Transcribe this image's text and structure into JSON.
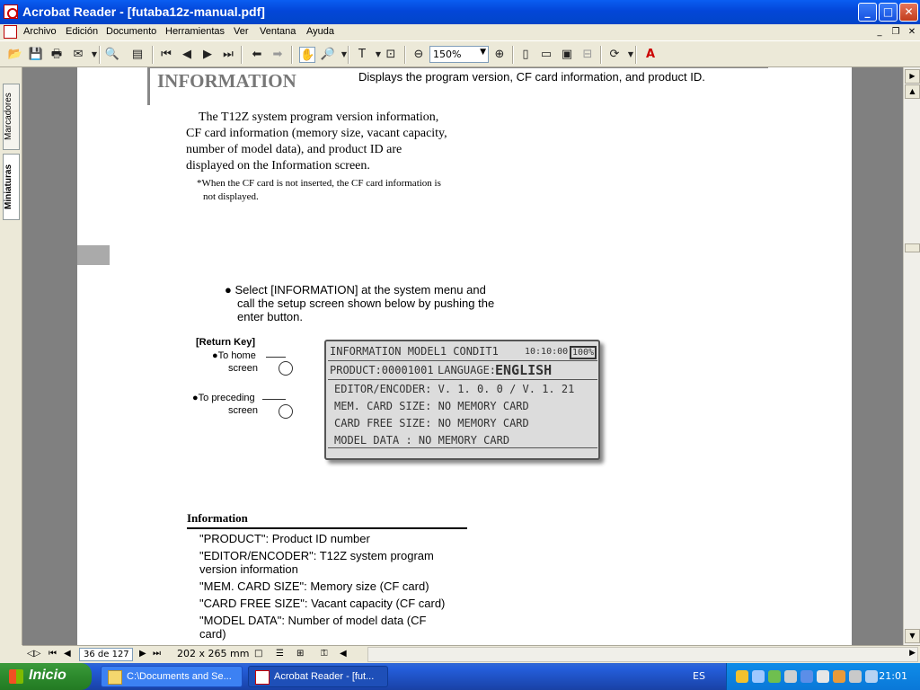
{
  "window": {
    "title": "Acrobat Reader - [futaba12z-manual.pdf]",
    "minimize": "_",
    "maximize": "□",
    "close": "✕"
  },
  "menu": [
    "Archivo",
    "Edición",
    "Documento",
    "Herramientas",
    "Ver",
    "Ventana",
    "Ayuda"
  ],
  "toolbar": {
    "zoom_value": "150%"
  },
  "sidetabs": {
    "bookmarks": "Marcadores",
    "thumbnails": "Miniaturas"
  },
  "doc": {
    "heading": "INFORMATION",
    "subheading": "Displays the program version, CF card information, and product ID.",
    "intro_lines": [
      "The T12Z system program version information,",
      "CF card information (memory size, vacant capacity,",
      "number of model data), and product ID are",
      "displayed on the Information screen."
    ],
    "note_lines": [
      "*When the CF card is not inserted, the CF card information is",
      "not displayed."
    ],
    "select_lines": [
      "● Select [INFORMATION] at the system menu and",
      "call the setup screen shown below by pushing the",
      "enter button."
    ],
    "return_key": "[Return Key]",
    "to_home": "●To home",
    "to_home_2": "screen",
    "to_preceding": "●To preceding",
    "to_preceding_2": "screen",
    "lcd": {
      "header": "INFORMATION   MODEL1   CONDIT1",
      "time": "10:10:00",
      "battery": "100%",
      "product": "PRODUCT:00001001",
      "language_label": "LANGUAGE:",
      "language_value": "ENGLISH",
      "rows": [
        "EDITOR/ENCODER:  V. 1. 0. 0 / V.  1. 21",
        "MEM. CARD SIZE:  NO MEMORY CARD",
        "CARD FREE SIZE:  NO MEMORY CARD",
        "MODEL DATA    :  NO MEMORY CARD"
      ]
    },
    "info_title": "Information",
    "info_items": [
      "\"PRODUCT\": Product ID number",
      "\"EDITOR/ENCODER\": T12Z system program",
      "version information",
      "\"MEM. CARD SIZE\":  Memory size (CF card)",
      "\"CARD FREE SIZE\": Vacant capacity (CF card)",
      "\"MODEL DATA\": Number of model data (CF",
      "card)"
    ]
  },
  "status": {
    "page": "36 de 127",
    "size": "202 x 265  mm"
  },
  "taskbar": {
    "start": "Inicio",
    "task1": "C:\\Documents and Se...",
    "task2": "Acrobat Reader - [fut...",
    "lang": "ES",
    "clock": "21:01"
  },
  "colors": {
    "titlebar": "#0a5ef2",
    "taskbar": "#245edb",
    "start": "#2d8a2d",
    "lcd_bg": "#dcdcdc"
  }
}
